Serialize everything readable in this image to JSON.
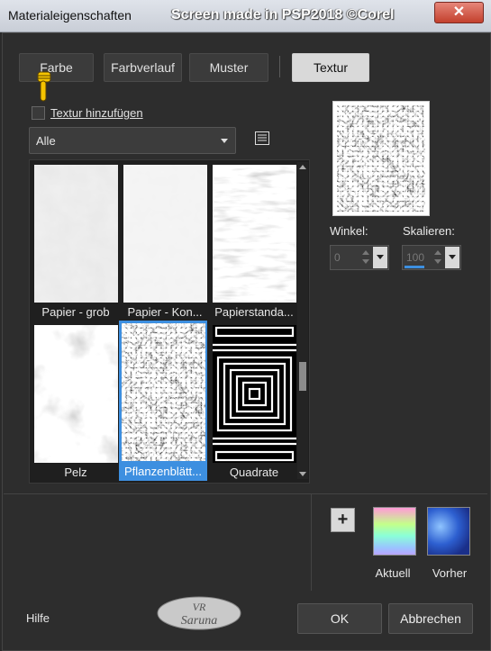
{
  "window": {
    "title": "Materialeigenschaften",
    "watermark": "Screen made in PSP2018 ©Corel",
    "close_label": "✕"
  },
  "tabs": [
    {
      "label": "Farbe",
      "active": false
    },
    {
      "label": "Farbverlauf",
      "active": false
    },
    {
      "label": "Muster",
      "active": false
    },
    {
      "label": "Textur",
      "active": true
    }
  ],
  "add_texture": {
    "label": "Textur hinzufügen",
    "checked": false
  },
  "category_select": {
    "value": "Alle"
  },
  "textures": [
    {
      "label": "Papier - grob",
      "selected": false
    },
    {
      "label": "Papier - Kon...",
      "selected": false
    },
    {
      "label": "Papierstanda...",
      "selected": false
    },
    {
      "label": "Pelz",
      "selected": false
    },
    {
      "label": "Pflanzenblätt...",
      "selected": true
    },
    {
      "label": "Quadrate",
      "selected": false
    }
  ],
  "angle": {
    "label": "Winkel:",
    "value": "0"
  },
  "scale": {
    "label": "Skalieren:",
    "value": "100"
  },
  "current_swatch": {
    "label": "Aktuell"
  },
  "previous_swatch": {
    "label": "Vorher"
  },
  "footer": {
    "help_label": "Hilfe",
    "logo_top": "VR",
    "logo_bottom": "Saruna",
    "ok_label": "OK",
    "cancel_label": "Abbrechen"
  },
  "colors": {
    "accent": "#3d8fe0",
    "close_red": "#c3402c"
  }
}
